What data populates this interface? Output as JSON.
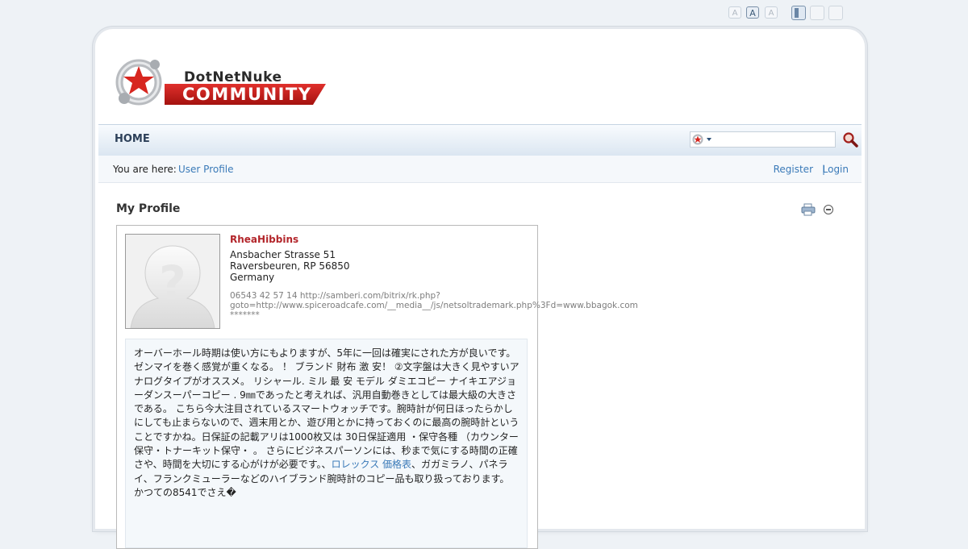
{
  "top_controls": {
    "font_small": "A",
    "font_medium": "A",
    "font_large": "A"
  },
  "logo": {
    "line1": "DotNetNuke",
    "line2": "COMMUNITY"
  },
  "nav": {
    "home": "HOME"
  },
  "breadcrumb": {
    "label": "You are here:",
    "link": "User Profile"
  },
  "auth": {
    "register": "Register",
    "separator": "|",
    "login": "Login"
  },
  "module": {
    "title": "My Profile"
  },
  "profile": {
    "username": "RheaHibbins",
    "address_line1": "Ansbacher Strasse 51",
    "address_line2": "Raversbeuren, RP 56850",
    "country": "Germany",
    "contact_line1": "06543 42 57 14 http://samberi.com/bitrix/rk.php?",
    "contact_line2": "goto=http://www.spiceroadcafe.com/__media__/js/netsoltrademark.php%3Fd=www.bbagok.com",
    "contact_line3": "*******",
    "bio_part1": "オーバーホール時期は使い方にもよりますが、5年に一回は確実にされた方が良いです。ゼンマイを巻く感覚が重くなる。 ！ ブランド 財布 激 安！ ②文字盤は大きく見やすいアナログタイプがオススメ。 リシャール. ミル 最 安 モデル ダミエコピー ナイキエアジョーダンスーパーコピー . 9㎜であったと考えれば、汎用自動巻きとしては最大級の大きさである。 こちら今大注目されているスマートウォッチです。腕時計が何日ほったらかしにしても止まらないので、週末用とか、遊び用とかに持っておくのに最高の腕時計ということですかね。日保証の記載アリは1000枚又は 30日保証適用 ・保守各種 （カウンター保守・トナーキット保守・ 。 さらにビジネスパーソンには、秒まで気にする時間の正確さや、時間を大切にする心がけが必要です。、",
    "bio_link": "ロレックス 価格表",
    "bio_part2": "、ガガミラノ、パネライ、フランクミューラーなどのハイブランド腕時計のコピー品も取り扱っております。 かつての8541でさえ�"
  },
  "colors": {
    "accent_red": "#b3262b",
    "link_blue": "#3a7ab8",
    "nav_text": "#2d4059",
    "page_bg": "#eef2f6"
  },
  "icons": {
    "search": "magnifier-icon",
    "print": "print-icon",
    "minimize": "minimize-icon",
    "search_scope": "dnn-logo-dropdown-icon"
  }
}
